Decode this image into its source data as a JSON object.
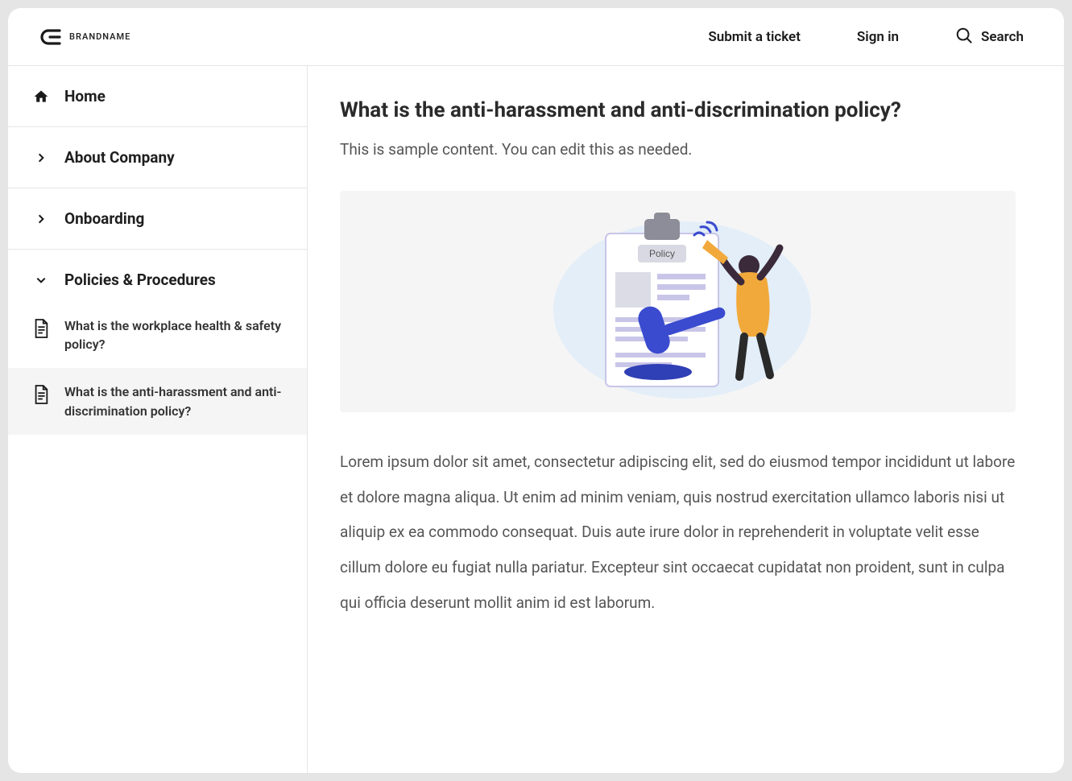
{
  "header": {
    "brand_name": "BRANDNAME",
    "submit_ticket": "Submit a ticket",
    "sign_in": "Sign in",
    "search_label": "Search"
  },
  "sidebar": {
    "home": "Home",
    "about": "About Company",
    "onboarding": "Onboarding",
    "policies_section": "Policies & Procedures",
    "subitems": [
      {
        "label": "What is the workplace health & safety policy?"
      },
      {
        "label": "What is the anti-harassment and anti-discrimination policy?"
      }
    ]
  },
  "article": {
    "title": "What is the anti-harassment and anti-discrimination policy?",
    "intro": "This is sample content. You can edit this as needed.",
    "illustration_badge": "Policy",
    "body": "Lorem ipsum dolor sit amet, consectetur adipiscing elit, sed do eiusmod tempor incididunt ut labore et dolore magna aliqua. Ut enim ad minim veniam, quis nostrud exercitation ullamco laboris nisi ut aliquip ex ea commodo consequat. Duis aute irure dolor in reprehenderit in voluptate velit esse cillum dolore eu fugiat nulla pariatur. Excepteur sint occaecat cupidatat non proident, sunt in culpa qui officia deserunt mollit anim id est laborum."
  }
}
